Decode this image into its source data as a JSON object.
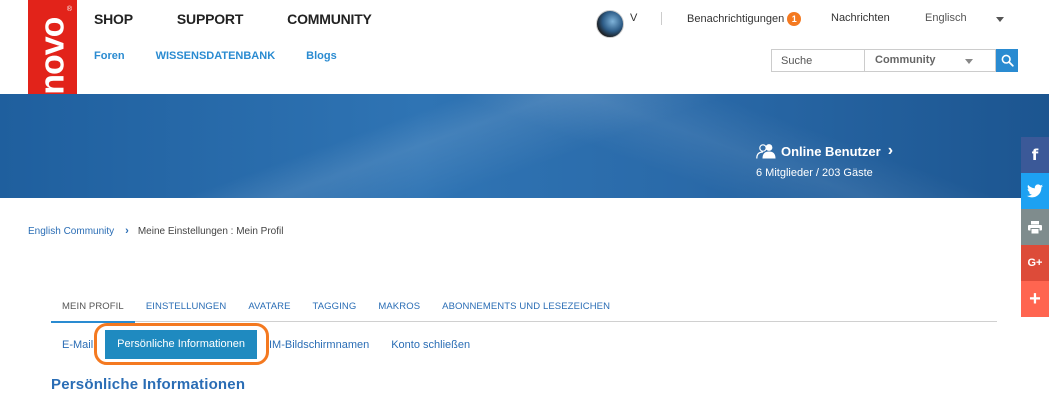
{
  "brand": {
    "logo_text": "Lenovo",
    "registered": "®",
    "color": "#e2231a"
  },
  "main_nav": [
    {
      "label": "SHOP"
    },
    {
      "label": "SUPPORT"
    },
    {
      "label": "COMMUNITY"
    }
  ],
  "sub_nav": [
    {
      "label": "Foren"
    },
    {
      "label": "WISSENSDATENBANK"
    },
    {
      "label": "Blogs"
    }
  ],
  "user_bar": {
    "username": "V",
    "notifications_label": "Benachrichtigungen",
    "notifications_count": "1",
    "messages_label": "Nachrichten",
    "language": "Englisch"
  },
  "search": {
    "placeholder": "Suche",
    "scope": "Community"
  },
  "banner": {
    "online_title": "Online Benutzer",
    "online_chevron": "›",
    "online_counts": "6 Mitglieder / 203 Gäste"
  },
  "social": [
    {
      "icon": "facebook-icon",
      "glyph": "f",
      "color": "#3b5998"
    },
    {
      "icon": "twitter-icon",
      "glyph": "t",
      "color": "#1da1f2"
    },
    {
      "icon": "print-icon",
      "glyph": "⎙",
      "color": "#7f8c8d"
    },
    {
      "icon": "google-plus-icon",
      "glyph": "G+",
      "color": "#dd4b39"
    },
    {
      "icon": "share-plus-icon",
      "glyph": "+",
      "color": "#ff6550"
    }
  ],
  "breadcrumb": {
    "root": "English Community",
    "separator": "›",
    "current": "Meine Einstellungen : Mein Profil"
  },
  "tabs": [
    {
      "label": "MEIN PROFIL",
      "active": true
    },
    {
      "label": "EINSTELLUNGEN"
    },
    {
      "label": "AVATARE"
    },
    {
      "label": "TAGGING"
    },
    {
      "label": "MAKROS"
    },
    {
      "label": "ABONNEMENTS UND LESEZEICHEN"
    }
  ],
  "subtabs": [
    {
      "label": "E-Mail"
    },
    {
      "label": "Persönliche Informationen",
      "active": true
    },
    {
      "label": "IM-Bildschirmnamen"
    },
    {
      "label": "Konto schließen"
    }
  ],
  "section_title": "Persönliche Informationen",
  "colors": {
    "accent": "#2a8bd1",
    "highlight": "#f47920",
    "badge": "#f47920"
  }
}
